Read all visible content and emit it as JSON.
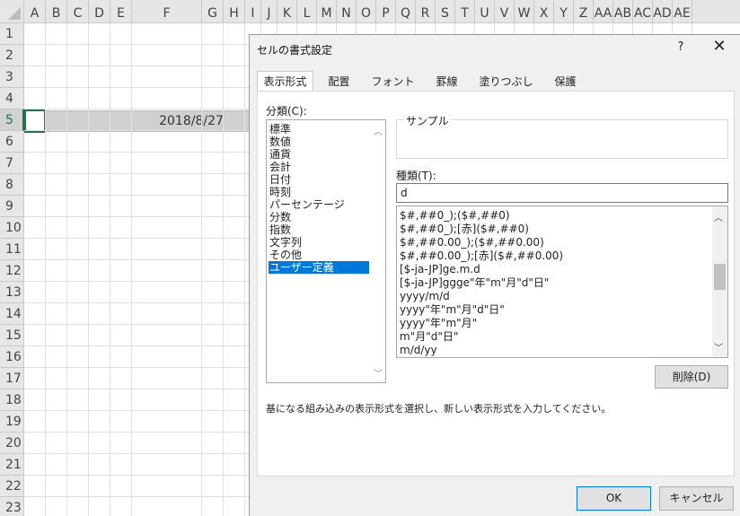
{
  "sheet": {
    "columns": [
      "A",
      "B",
      "C",
      "D",
      "E",
      "F",
      "G",
      "H",
      "I",
      "J",
      "K",
      "L",
      "M",
      "N",
      "O",
      "P",
      "Q",
      "R",
      "S",
      "T",
      "U",
      "V",
      "W",
      "X",
      "Y",
      "Z",
      "AA",
      "AB",
      "AC",
      "AD",
      "AE"
    ],
    "rows": [
      "1",
      "2",
      "3",
      "4",
      "5",
      "6",
      "7",
      "8",
      "9",
      "10",
      "11",
      "12",
      "13",
      "14",
      "15",
      "16",
      "17",
      "18",
      "19",
      "20",
      "21",
      "22",
      "23"
    ],
    "selected_row": "5",
    "cell_F5": "2018/8/27"
  },
  "dialog": {
    "title": "セルの書式設定",
    "help": "?",
    "close": "✕",
    "tabs": [
      {
        "label": "表示形式",
        "active": true
      },
      {
        "label": "配置"
      },
      {
        "label": "フォント"
      },
      {
        "label": "罫線"
      },
      {
        "label": "塗りつぶし"
      },
      {
        "label": "保護"
      }
    ],
    "category_label": "分類(C):",
    "categories": [
      "標準",
      "数値",
      "通貨",
      "会計",
      "日付",
      "時刻",
      "パーセンテージ",
      "分数",
      "指数",
      "文字列",
      "その他",
      "ユーザー定義"
    ],
    "selected_category": "ユーザー定義",
    "sample_label": "サンプル",
    "type_label": "種類(T):",
    "type_value": "d",
    "formats": [
      "$#,##0_);($#,##0)",
      "$#,##0_);[赤]($#,##0)",
      "$#,##0.00_);($#,##0.00)",
      "$#,##0.00_);[赤]($#,##0.00)",
      "[$-ja-JP]ge.m.d",
      "[$-ja-JP]ggge\"年\"m\"月\"d\"日\"",
      "yyyy/m/d",
      "yyyy\"年\"m\"月\"d\"日\"",
      "yyyy\"年\"m\"月\"",
      "m\"月\"d\"日\"",
      "m/d/yy"
    ],
    "format_scroll_position": 0.45,
    "delete_button": "削除(D)",
    "hint": "基になる組み込みの表示形式を選択し、新しい表示形式を入力してください。",
    "ok_button": "OK",
    "cancel_button": "キャンセル"
  }
}
